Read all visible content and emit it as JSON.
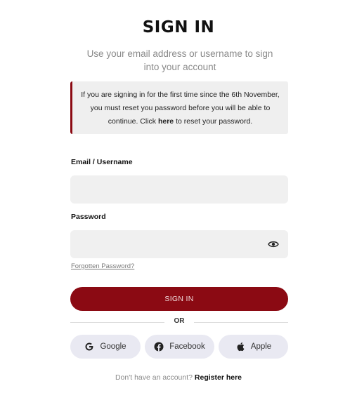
{
  "header": {
    "title": "SIGN IN",
    "subtitle": "Use your email address or username to sign into your account"
  },
  "notice": {
    "text_before": "If you are signing in for the first time since the 6th November, you must reset you password before you will be able to continue. Click ",
    "link": "here",
    "text_after": " to reset your password.",
    "accent_color": "#8b0a13"
  },
  "form": {
    "email_label": "Email / Username",
    "email_value": "",
    "password_label": "Password",
    "password_value": "",
    "forgot_link": "Forgotten Password?",
    "submit_label": "SIGN IN",
    "submit_color": "#8b0a13"
  },
  "divider": {
    "text": "OR"
  },
  "social": {
    "google_label": "Google",
    "google_icon": "google-icon",
    "facebook_label": "Facebook",
    "facebook_icon": "facebook-icon",
    "apple_label": "Apple",
    "apple_icon": "apple-icon"
  },
  "footer": {
    "prompt": "Don't have an account?",
    "register_link": "Register here"
  }
}
